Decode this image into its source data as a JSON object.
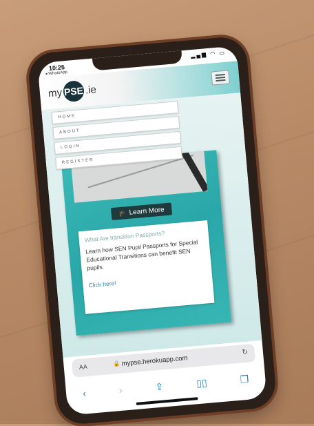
{
  "status": {
    "time": "10:25",
    "back_app": "◂ WhatsApp"
  },
  "logo": {
    "pre": "my",
    "circle": "PSE",
    "post": ".ie"
  },
  "menu": [
    "HOME",
    "ABOUT",
    "LOGIN",
    "REGISTER"
  ],
  "card": {
    "button_label": "Learn More",
    "question": "What Are transition Passports?",
    "description": "Learn how SEN Pupil Passports for Special Educational Transitions can benefit SEN pupils.",
    "link": "Click here!"
  },
  "browser": {
    "aa": "AA",
    "url": "mypse.herokuapp.com"
  },
  "colors": {
    "teal": "#2aa7a8",
    "button": "#1f3a3d",
    "logo_circle": "#18323a",
    "link": "#2b8bb8"
  },
  "icons": [
    "hamburger-icon",
    "graduation-cap-icon",
    "lock-icon",
    "reload-icon",
    "back-arrow-icon",
    "forward-arrow-icon",
    "share-icon",
    "bookmarks-icon",
    "tabs-icon"
  ]
}
